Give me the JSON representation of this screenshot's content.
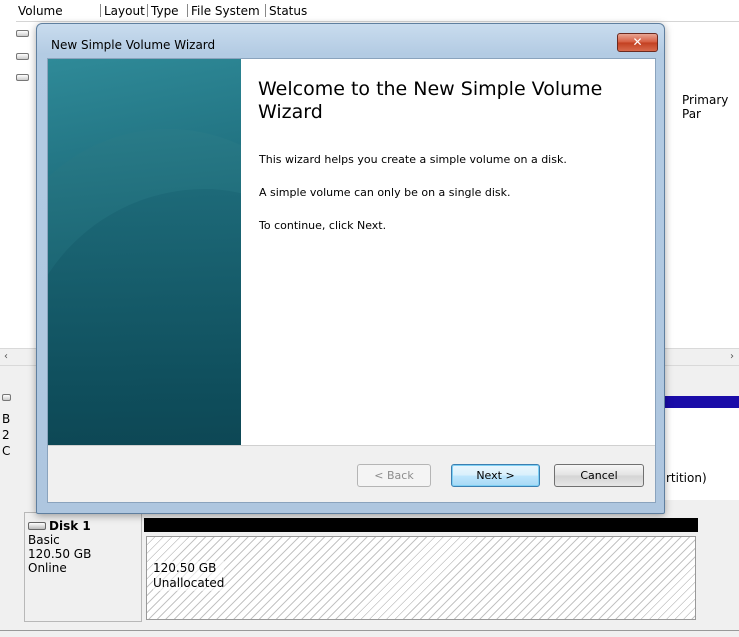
{
  "background": {
    "columns": [
      "Volume",
      "Layout",
      "Type",
      "File System",
      "Status"
    ],
    "primary_partition_text": "Primary Par",
    "scroll_left": "‹",
    "scroll_right": "›",
    "disk0_peek": [
      "B",
      "2",
      "C"
    ],
    "disk0_partition_label": "rtition)",
    "disk1": {
      "name": "Disk 1",
      "type": "Basic",
      "size": "120.50 GB",
      "status": "Online",
      "unallocated_size": "120.50 GB",
      "unallocated_label": "Unallocated"
    }
  },
  "wizard": {
    "title": "New Simple Volume Wizard",
    "close_glyph": "✕",
    "heading": "Welcome to the New Simple Volume Wizard",
    "lines": [
      "This wizard helps you create a simple volume on a disk.",
      "A simple volume can only be on a single disk.",
      "To continue, click Next."
    ],
    "buttons": {
      "back": "< Back",
      "next": "Next >",
      "cancel": "Cancel"
    }
  }
}
